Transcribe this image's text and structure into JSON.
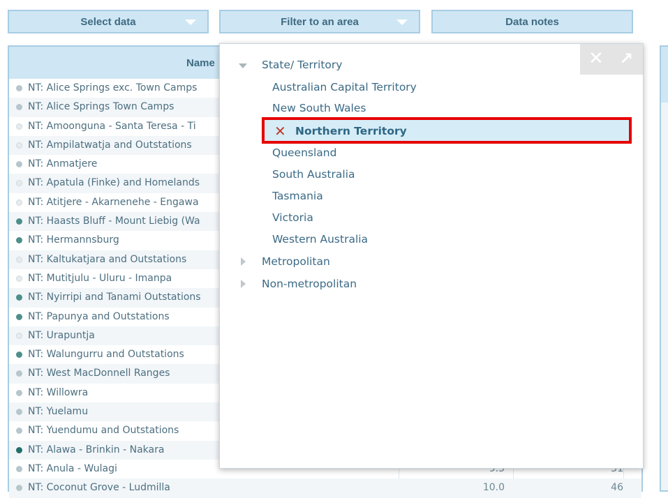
{
  "toolbar": {
    "select_data": "Select data",
    "filter_area": "Filter to an area",
    "data_notes": "Data notes"
  },
  "table": {
    "header_name": "Name",
    "rows": [
      {
        "name": "NT: Alice Springs exc. Town Camps",
        "v1": "",
        "v2": "",
        "dot": "grey"
      },
      {
        "name": "NT: Alice Springs Town Camps",
        "v1": "",
        "v2": "",
        "dot": "grey"
      },
      {
        "name": "NT: Amoonguna - Santa Teresa - Ti",
        "v1": "",
        "v2": "",
        "dot": "light"
      },
      {
        "name": "NT: Ampilatwatja and Outstations",
        "v1": "",
        "v2": "",
        "dot": "light"
      },
      {
        "name": "NT: Anmatjere",
        "v1": "",
        "v2": "",
        "dot": "grey"
      },
      {
        "name": "NT: Apatula (Finke) and Homelands",
        "v1": "",
        "v2": "",
        "dot": "light"
      },
      {
        "name": "NT: Atitjere - Akarnenehe - Engawa",
        "v1": "",
        "v2": "",
        "dot": "light"
      },
      {
        "name": "NT: Haasts Bluff - Mount Liebig (Wa",
        "v1": "",
        "v2": "",
        "dot": "teal"
      },
      {
        "name": "NT: Hermannsburg",
        "v1": "",
        "v2": "",
        "dot": "teal"
      },
      {
        "name": "NT: Kaltukatjara and Outstations",
        "v1": "",
        "v2": "",
        "dot": "light"
      },
      {
        "name": "NT: Mutitjulu - Uluru - Imanpa",
        "v1": "",
        "v2": "",
        "dot": "light"
      },
      {
        "name": "NT: Nyirripi and Tanami Outstations",
        "v1": "",
        "v2": "",
        "dot": "teal"
      },
      {
        "name": "NT: Papunya and Outstations",
        "v1": "",
        "v2": "",
        "dot": "teal"
      },
      {
        "name": "NT: Urapuntja",
        "v1": "",
        "v2": "",
        "dot": "light"
      },
      {
        "name": "NT: Walungurru and Outstations",
        "v1": "",
        "v2": "",
        "dot": "teal"
      },
      {
        "name": "NT: West MacDonnell Ranges",
        "v1": "",
        "v2": "",
        "dot": "grey"
      },
      {
        "name": "NT: Willowra",
        "v1": "",
        "v2": "",
        "dot": "grey"
      },
      {
        "name": "NT: Yuelamu",
        "v1": "",
        "v2": "",
        "dot": "grey"
      },
      {
        "name": "NT: Yuendumu and Outstations",
        "v1": "",
        "v2": "",
        "dot": "grey"
      },
      {
        "name": "NT: Alawa - Brinkin - Nakara",
        "v1": "",
        "v2": "",
        "dot": "darkteal"
      },
      {
        "name": "NT: Anula - Wulagi",
        "v1": "9.5",
        "v2": "31",
        "dot": "grey"
      },
      {
        "name": "NT: Coconut Grove - Ludmilla",
        "v1": "10.0",
        "v2": "46",
        "dot": "grey"
      }
    ]
  },
  "filter_panel": {
    "state_territory_label": "State/ Territory",
    "states": [
      "Australian Capital Territory",
      "New South Wales",
      "Northern Territory",
      "Queensland",
      "South Australia",
      "Tasmania",
      "Victoria",
      "Western Australia"
    ],
    "selected_state": "Northern Territory",
    "metropolitan_label": "Metropolitan",
    "non_metropolitan_label": "Non-metropolitan",
    "close_icon_glyph": "✕",
    "expand_icon_glyph": "↗"
  },
  "colors": {
    "button_bg": "#cfe6f4",
    "button_border": "#a7cde4",
    "highlight_border": "#e60000",
    "selected_bg": "#d6edf7"
  }
}
